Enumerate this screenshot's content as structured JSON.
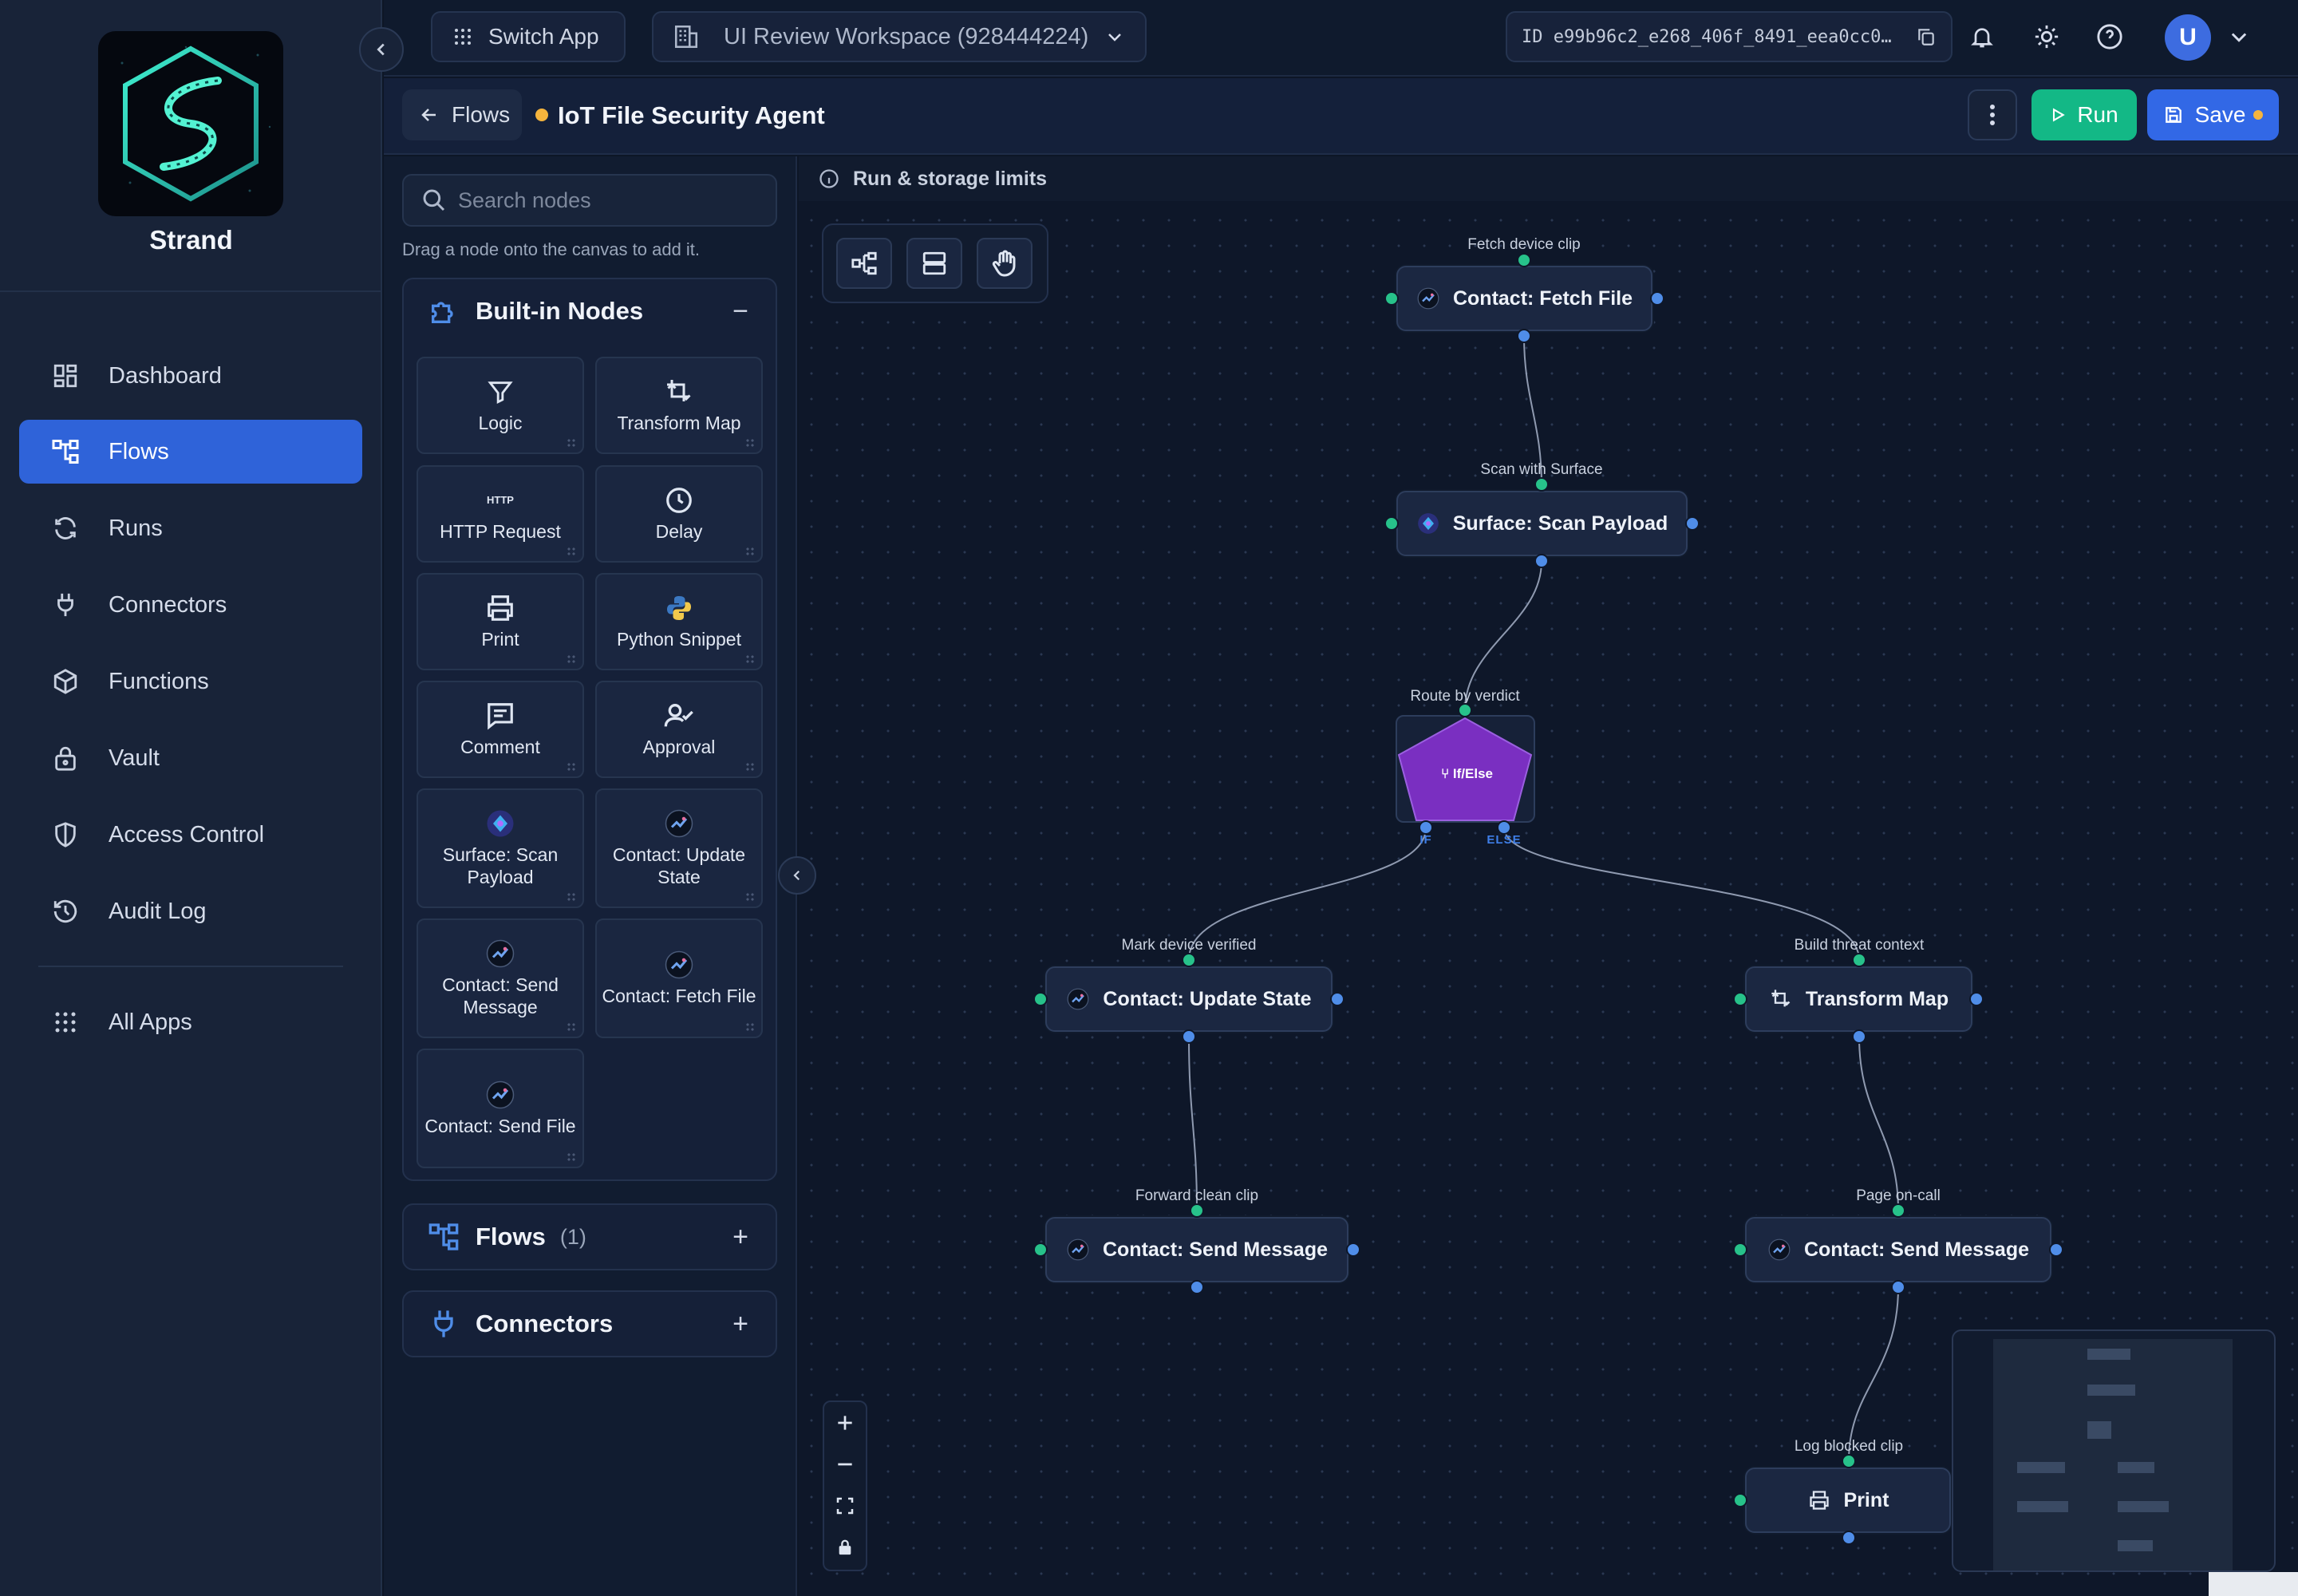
{
  "app": {
    "brand": "Strand",
    "accent": "#2f63d9"
  },
  "sidebar": {
    "items": [
      {
        "label": "Dashboard",
        "icon": "dashboard-icon",
        "active": false
      },
      {
        "label": "Flows",
        "icon": "flows-icon",
        "active": true
      },
      {
        "label": "Runs",
        "icon": "runs-icon",
        "active": false
      },
      {
        "label": "Connectors",
        "icon": "plug-icon",
        "active": false
      },
      {
        "label": "Functions",
        "icon": "cube-icon",
        "active": false
      },
      {
        "label": "Vault",
        "icon": "lock-icon",
        "active": false
      },
      {
        "label": "Access Control",
        "icon": "shield-icon",
        "active": false
      },
      {
        "label": "Audit Log",
        "icon": "history-icon",
        "active": false
      },
      {
        "label": "All Apps",
        "icon": "grid-icon",
        "active": false
      }
    ]
  },
  "topbar": {
    "switch_app": "Switch App",
    "workspace": "UI Review Workspace (928444224)",
    "flow_id": "ID e99b96c2_e268_406f_8491_eea0cc0…",
    "avatar": "U"
  },
  "header": {
    "back": "Flows",
    "title": "IoT File Security Agent",
    "run": "Run",
    "save": "Save",
    "unsaved_color": "#f5b43d"
  },
  "panel": {
    "search_placeholder": "Search nodes",
    "drag_hint": "Drag a node onto the canvas to add it.",
    "builtin_title": "Built-in Nodes",
    "builtin_action": "−",
    "tiles": [
      {
        "label": "Logic",
        "icon": "filter-icon"
      },
      {
        "label": "Transform Map",
        "icon": "transform-icon"
      },
      {
        "label": "HTTP Request",
        "icon": "http-icon",
        "icon_text": "HTTP"
      },
      {
        "label": "Delay",
        "icon": "clock-icon"
      },
      {
        "label": "Print",
        "icon": "printer-icon"
      },
      {
        "label": "Python Snippet",
        "icon": "python-icon"
      },
      {
        "label": "Comment",
        "icon": "comment-icon"
      },
      {
        "label": "Approval",
        "icon": "approval-icon"
      },
      {
        "label": "Surface: Scan Payload",
        "icon": "surface-icon"
      },
      {
        "label": "Contact: Update State",
        "icon": "contact-icon"
      },
      {
        "label": "Contact: Send Message",
        "icon": "contact-icon"
      },
      {
        "label": "Contact: Fetch File",
        "icon": "contact-icon"
      },
      {
        "label": "Contact: Send File",
        "icon": "contact-icon"
      }
    ],
    "flows_title": "Flows",
    "flows_count": "(1)",
    "connectors_title": "Connectors",
    "add_action": "+"
  },
  "canvas": {
    "limits": "Run & storage limits",
    "nodes": [
      {
        "id": "n1",
        "title": "Contact: Fetch File",
        "label": "Fetch device clip",
        "icon": "contact-icon"
      },
      {
        "id": "n2",
        "title": "Surface: Scan Payload",
        "label": "Scan with Surface",
        "icon": "surface-icon"
      },
      {
        "id": "n3",
        "title": "If/Else",
        "label": "Route by verdict",
        "icon": "branch-icon",
        "branch_if": "IF",
        "branch_else": "ELSE",
        "color": "#7a2fc1"
      },
      {
        "id": "n4",
        "title": "Contact: Update State",
        "label": "Mark device verified",
        "icon": "contact-icon"
      },
      {
        "id": "n5",
        "title": "Transform Map",
        "label": "Build threat context",
        "icon": "transform-icon"
      },
      {
        "id": "n6",
        "title": "Contact: Send Message",
        "label": "Forward clean clip",
        "icon": "contact-icon"
      },
      {
        "id": "n7",
        "title": "Contact: Send Message",
        "label": "Page on-call",
        "icon": "contact-icon"
      },
      {
        "id": "n8",
        "title": "Print",
        "label": "Log blocked clip",
        "icon": "printer-icon"
      }
    ]
  }
}
